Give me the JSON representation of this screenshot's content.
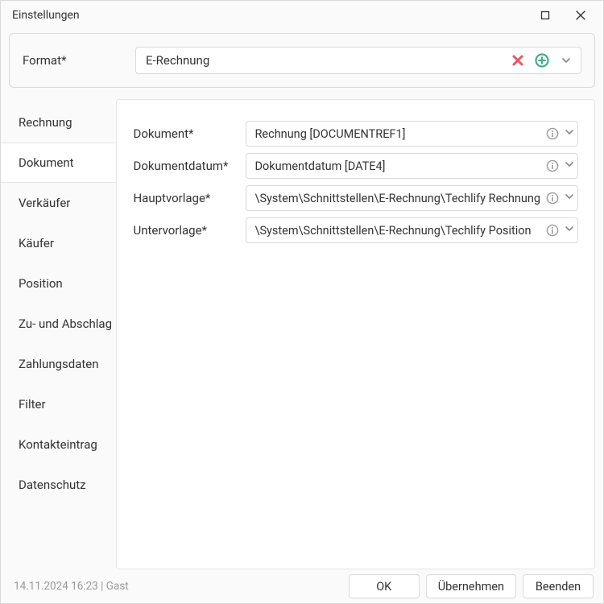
{
  "window": {
    "title": "Einstellungen"
  },
  "format": {
    "label": "Format*",
    "value": "E-Rechnung"
  },
  "sidebar": {
    "items": [
      {
        "label": "Rechnung",
        "active": false
      },
      {
        "label": "Dokument",
        "active": true
      },
      {
        "label": "Verkäufer",
        "active": false
      },
      {
        "label": "Käufer",
        "active": false
      },
      {
        "label": "Position",
        "active": false
      },
      {
        "label": "Zu- und Abschlag",
        "active": false
      },
      {
        "label": "Zahlungsdaten",
        "active": false
      },
      {
        "label": "Filter",
        "active": false
      },
      {
        "label": "Kontakteintrag",
        "active": false
      },
      {
        "label": "Datenschutz",
        "active": false
      }
    ]
  },
  "form": {
    "rows": [
      {
        "label": "Dokument*",
        "value": "Rechnung [DOCUMENTREF1]"
      },
      {
        "label": "Dokumentdatum*",
        "value": "Dokumentdatum [DATE4]"
      },
      {
        "label": "Hauptvorlage*",
        "value": "\\System\\Schnittstellen\\E-Rechnung\\Techlify Rechnung"
      },
      {
        "label": "Untervorlage*",
        "value": "\\System\\Schnittstellen\\E-Rechnung\\Techlify Position"
      }
    ]
  },
  "footer": {
    "status": "14.11.2024 16:23 | Gast",
    "ok": "OK",
    "apply": "Übernehmen",
    "cancel": "Beenden"
  },
  "colors": {
    "clear_icon": "#ed5565",
    "add_icon": "#3fae8e"
  }
}
